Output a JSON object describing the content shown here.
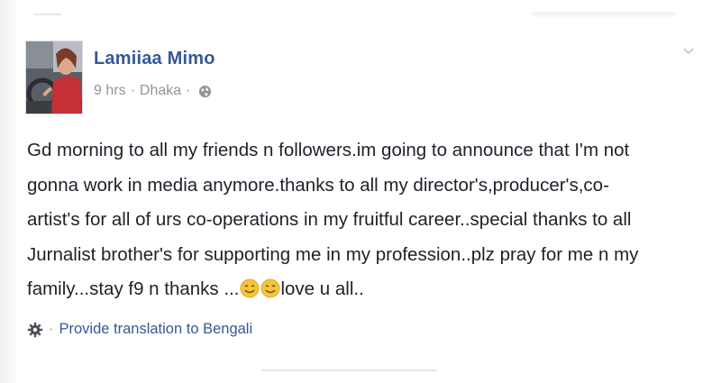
{
  "post": {
    "author": "Lamiiaa Mimo",
    "time": "9 hrs",
    "separator": "·",
    "location": "Dhaka",
    "privacy_icon": "globe-icon",
    "body_lines": [
      "Gd morning to all my friends n followers.im going to announce that I'm not",
      "gonna work in media anymore.thanks to all my director's,producer's,co-",
      "artist's for all of urs co-operations in my fruitful career..special thanks to all",
      "Jurnalist brother's for supporting me in my profession..plz pray for me n my"
    ],
    "body_last_line_start": "family...stay f9 n thanks ...",
    "body_last_line_end": "love u all..",
    "emoji_icon": "smiley-emoji-icon"
  },
  "translation": {
    "separator": "·",
    "link_text": "Provide translation to Bengali",
    "icon": "gear-icon"
  },
  "colors": {
    "link_blue": "#365899",
    "meta_gray": "#90949c",
    "text_dark": "#1d2129",
    "emoji_yellow": "#f7c23d"
  }
}
